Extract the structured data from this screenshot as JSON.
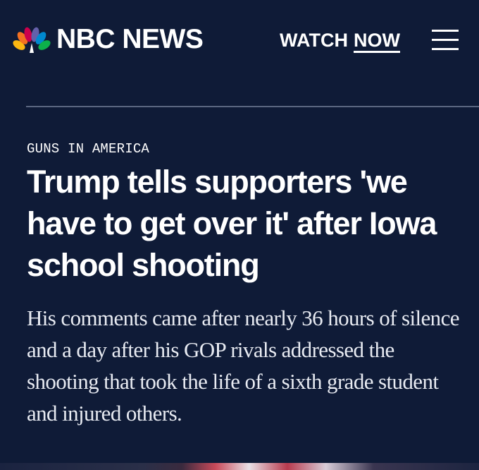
{
  "header": {
    "brand": "NBC NEWS",
    "watch_label": "WATCH",
    "now_label": "NOW",
    "menu_icon": "hamburger-menu-icon"
  },
  "article": {
    "eyebrow": "GUNS IN AMERICA",
    "headline": "Trump tells supporters 'we have to get over it' after Iowa school shooting",
    "dek": "His comments came after nearly 36 hours of silence and a day after his GOP rivals addressed the shooting that took the life of a sixth grade student and injured others."
  },
  "colors": {
    "background": "#0f1b37",
    "text": "#ffffff",
    "divider": "#5a6680",
    "peacock": [
      "#fcb711",
      "#f37021",
      "#cc004c",
      "#6460aa",
      "#0089d0",
      "#0db14b"
    ]
  }
}
